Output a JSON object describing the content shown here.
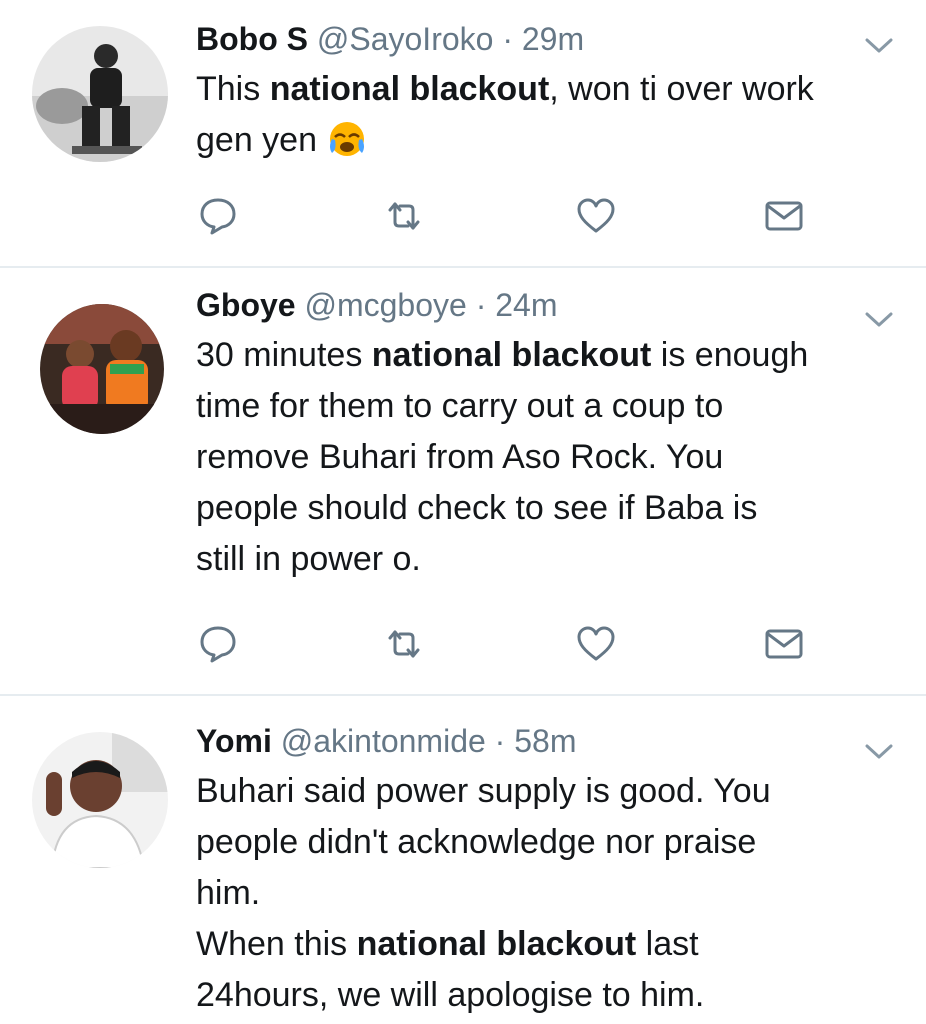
{
  "tweets": [
    {
      "name": "Bobo S",
      "handle": "@SayoIroko",
      "dot": "·",
      "time": "29m",
      "lines": [
        {
          "parts": [
            "This ",
            "national blackout",
            ", won ti over work"
          ]
        },
        {
          "parts": [
            "gen yen",
            "",
            ""
          ]
        }
      ],
      "emoji": "crying-face-emoji"
    },
    {
      "name": "Gboye",
      "handle": "@mcgboye",
      "dot": "·",
      "time": "24m",
      "lines": [
        {
          "parts": [
            "30 minutes ",
            "national blackout",
            " is enough"
          ]
        },
        {
          "parts": [
            "time for them to carry out a coup to",
            "",
            ""
          ]
        },
        {
          "parts": [
            "remove Buhari from Aso Rock. You",
            "",
            ""
          ]
        },
        {
          "parts": [
            "people should check to see if Baba is",
            "",
            ""
          ]
        },
        {
          "parts": [
            "still in power o.",
            "",
            ""
          ]
        }
      ]
    },
    {
      "name": "Yomi",
      "handle": "@akintonmide",
      "dot": "·",
      "time": "58m",
      "lines": [
        {
          "parts": [
            "Buhari said power supply is good. You",
            "",
            ""
          ]
        },
        {
          "parts": [
            "people didn't acknowledge nor praise",
            "",
            ""
          ]
        },
        {
          "parts": [
            "him.",
            "",
            ""
          ]
        },
        {
          "parts": [
            "When this ",
            "national blackout",
            " last"
          ]
        },
        {
          "parts": [
            "24hours, we will apologise to him.",
            "",
            ""
          ]
        }
      ]
    }
  ],
  "icons": {
    "reply": "reply-icon",
    "retweet": "retweet-icon",
    "like": "heart-icon",
    "message": "envelope-icon",
    "caret": "chevron-down-icon"
  },
  "colors": {
    "text": "#14171a",
    "secondary": "#657786",
    "icon": "#657786",
    "divider": "#e6ecf0"
  }
}
